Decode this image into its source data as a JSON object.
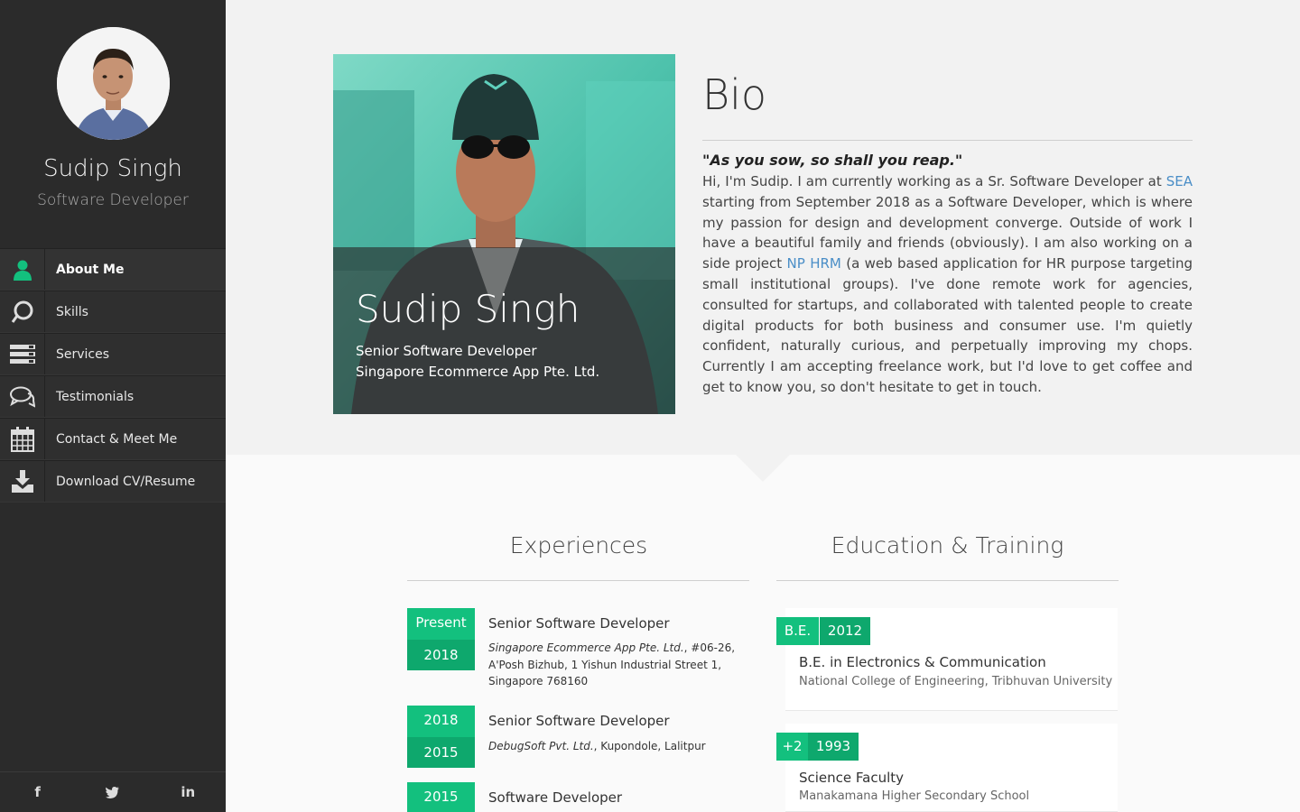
{
  "sidebar": {
    "name": "Sudip Singh",
    "role": "Software Developer",
    "nav": [
      {
        "label": "About Me",
        "icon": "user-icon",
        "active": true
      },
      {
        "label": "Skills",
        "icon": "skills-icon",
        "active": false
      },
      {
        "label": "Services",
        "icon": "services-icon",
        "active": false
      },
      {
        "label": "Testimonials",
        "icon": "chat-icon",
        "active": false
      },
      {
        "label": "Contact & Meet Me",
        "icon": "calendar-icon",
        "active": false
      },
      {
        "label": "Download CV/Resume",
        "icon": "download-icon",
        "active": false
      }
    ],
    "social": [
      {
        "icon": "facebook-icon",
        "glyph": "f"
      },
      {
        "icon": "twitter-icon",
        "glyph": "🐦"
      },
      {
        "icon": "linkedin-icon",
        "glyph": "in"
      }
    ]
  },
  "hero": {
    "name": "Sudip Singh",
    "title": "Senior Software Developer",
    "company": "Singapore Ecommerce App Pte. Ltd."
  },
  "bio": {
    "heading": "Bio",
    "quote": "\"As you sow, so shall you reap.\"",
    "text_1": "Hi, I'm Sudip. I am currently working as a Sr. Software Developer at ",
    "link_1": "SEA",
    "text_2": " starting from September 2018 as a Software Developer, which is where my passion for design and development converge. Outside of work I have a beautiful family and friends (obviously). I am also working on a side project ",
    "link_2": "NP HRM",
    "text_3": " (a web based application for HR purpose targeting small institutional groups). I've done remote work for agencies, consulted for startups, and collaborated with talented people to create digital products for both business and consumer use. I'm quietly confident, naturally curious, and perpetually improving my chops. Currently I am accepting freelance work, but I'd love to get coffee and get to know you, so don't hesitate to get in touch."
  },
  "experiences": {
    "heading": "Experiences",
    "items": [
      {
        "from": "Present",
        "to": "2018",
        "role": "Senior Software Developer",
        "company": "Singapore Ecommerce App Pte. Ltd.",
        "address": ", #06-26, A'Posh Bizhub, 1 Yishun Industrial Street 1, Singapore 768160"
      },
      {
        "from": "2018",
        "to": "2015",
        "role": "Senior Software Developer",
        "company": "DebugSoft Pvt. Ltd.",
        "address": ", Kupondole, Lalitpur"
      },
      {
        "from": "2015",
        "to": "",
        "role": "Software Developer",
        "company": "",
        "address": ""
      }
    ]
  },
  "education": {
    "heading": "Education & Training",
    "items": [
      {
        "degree": "B.E.",
        "year": "2012",
        "title": "B.E. in Electronics & Communication",
        "school": "National College of Engineering, Tribhuvan University"
      },
      {
        "degree": "+2",
        "year": "1993",
        "title": "Science Faculty",
        "school": "Manakamana Higher Secondary School"
      }
    ]
  },
  "colors": {
    "accent": "#13c07e",
    "sidebar": "#2b2b2b",
    "link": "#4a8ec7"
  }
}
